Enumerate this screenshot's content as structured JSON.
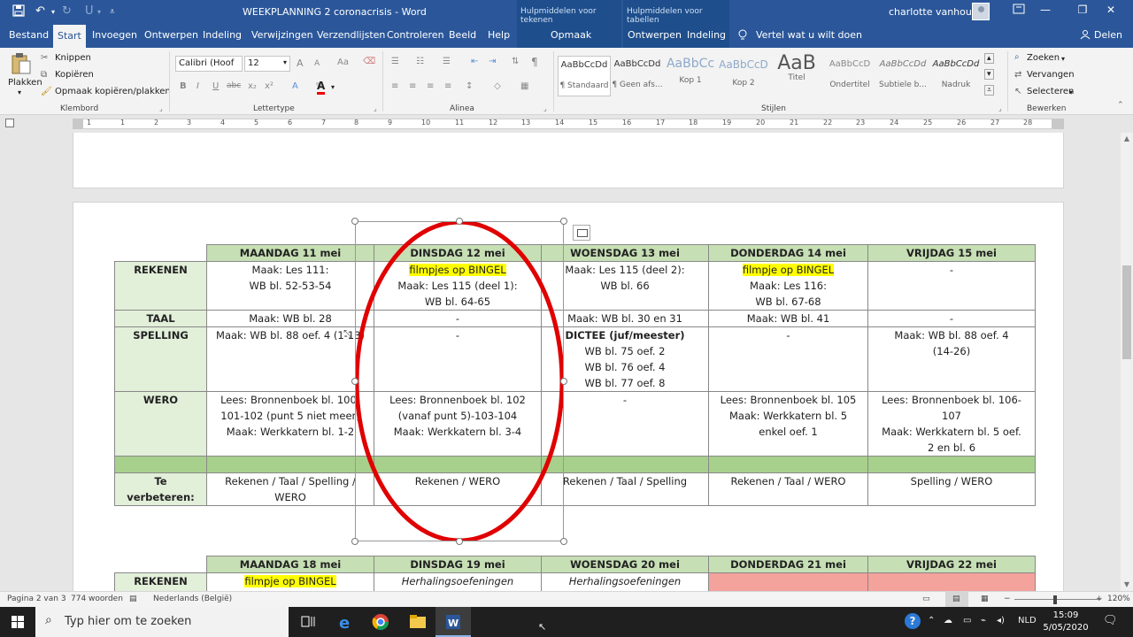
{
  "window": {
    "title": "WEEKPLANNING 2 coronacrisis  -  Word",
    "context_tools": [
      "Hulpmiddelen voor tekenen",
      "Hulpmiddelen voor tabellen"
    ],
    "user": "charlotte vanhoutte"
  },
  "tabs": {
    "file": "Bestand",
    "home": "Start",
    "insert": "Invoegen",
    "design": "Ontwerpen",
    "layout": "Indeling",
    "references": "Verwijzingen",
    "mailings": "Verzendlijsten",
    "review": "Controleren",
    "view": "Beeld",
    "help": "Help",
    "shape_format": "Opmaak",
    "table_design": "Ontwerpen",
    "table_layout": "Indeling",
    "tell_me": "Vertel wat u wilt doen",
    "share": "Delen"
  },
  "ribbon": {
    "clipboard": {
      "paste": "Plakken",
      "cut": "Knippen",
      "copy": "Kopiëren",
      "format_painter": "Opmaak kopiëren/plakken",
      "label": "Klembord"
    },
    "font": {
      "family": "Calibri (Hoof",
      "size": "12",
      "grow": "A",
      "shrink": "A",
      "case": "Aa",
      "bold": "B",
      "italic": "I",
      "underline": "U",
      "strike": "abc",
      "label": "Lettertype"
    },
    "paragraph": {
      "label": "Alinea"
    },
    "styles": {
      "items": [
        {
          "sample": "AaBbCcDd",
          "name": "¶ Standaard"
        },
        {
          "sample": "AaBbCcDd",
          "name": "¶ Geen afs..."
        },
        {
          "sample": "AaBbCc",
          "name": "Kop 1"
        },
        {
          "sample": "AaBbCcD",
          "name": "Kop 2"
        },
        {
          "sample": "AaB",
          "name": "Titel"
        },
        {
          "sample": "AaBbCcD",
          "name": "Ondertitel"
        },
        {
          "sample": "AaBbCcDd",
          "name": "Subtiele b..."
        },
        {
          "sample": "AaBbCcDd",
          "name": "Nadruk"
        }
      ],
      "label": "Stijlen"
    },
    "editing": {
      "find": "Zoeken",
      "replace": "Vervangen",
      "select": "Selecteren",
      "label": "Bewerken"
    }
  },
  "ruler": {
    "marks": [
      "1",
      "1",
      "2",
      "3",
      "4",
      "5",
      "6",
      "7",
      "8",
      "9",
      "10",
      "11",
      "12",
      "13",
      "14",
      "15",
      "16",
      "17",
      "18",
      "19",
      "20",
      "21",
      "22",
      "23",
      "24",
      "25",
      "26",
      "27",
      "28"
    ]
  },
  "table1": {
    "headers": [
      "MAANDAG 11 mei",
      "DINSDAG 12 mei",
      "WOENSDAG 13 mei",
      "DONDERDAG 14 mei",
      "VRIJDAG 15 mei"
    ],
    "rows": [
      {
        "subject": "REKENEN",
        "cells": [
          {
            "lines": [
              {
                "t": "Maak: Les 111:"
              },
              {
                "t": "WB bl. 52-53-54"
              }
            ]
          },
          {
            "lines": [
              {
                "t": "filmpjes op BINGEL",
                "hl": true
              },
              {
                "t": "Maak: Les 115 (deel 1):"
              },
              {
                "t": "WB bl. 64-65"
              }
            ]
          },
          {
            "lines": [
              {
                "t": "Maak: Les 115 (deel 2):"
              },
              {
                "t": "WB bl. 66"
              }
            ]
          },
          {
            "lines": [
              {
                "t": "filmpje op BINGEL",
                "hl": true
              },
              {
                "t": "Maak: Les 116:"
              },
              {
                "t": "WB bl. 67-68"
              }
            ]
          },
          {
            "lines": [
              {
                "t": "-"
              }
            ]
          }
        ]
      },
      {
        "subject": "TAAL",
        "cells": [
          {
            "lines": [
              {
                "t": "Maak: WB bl. 28"
              }
            ]
          },
          {
            "lines": [
              {
                "t": "-"
              }
            ]
          },
          {
            "lines": [
              {
                "t": "Maak: WB bl. 30 en 31"
              }
            ]
          },
          {
            "lines": [
              {
                "t": "Maak: WB bl. 41"
              }
            ]
          },
          {
            "lines": [
              {
                "t": "-"
              }
            ]
          }
        ]
      },
      {
        "subject": "SPELLING",
        "cells": [
          {
            "lines": [
              {
                "t": "Maak: WB bl. 88 oef. 4 (1-13)"
              }
            ]
          },
          {
            "lines": [
              {
                "t": "-"
              }
            ]
          },
          {
            "lines": [
              {
                "t": "DICTEE (juf/meester)",
                "b": true
              },
              {
                "t": "WB bl. 75 oef. 2"
              },
              {
                "t": "WB bl. 76 oef. 4"
              },
              {
                "t": "WB bl. 77 oef. 8"
              }
            ]
          },
          {
            "lines": [
              {
                "t": "-"
              }
            ]
          },
          {
            "lines": [
              {
                "t": "Maak: WB bl. 88 oef. 4"
              },
              {
                "t": "(14-26)"
              }
            ]
          }
        ]
      },
      {
        "subject": "WERO",
        "cells": [
          {
            "lines": [
              {
                "t": "Lees: Bronnenboek bl. 100-"
              },
              {
                "t": "101-102 (punt 5 niet meer)"
              },
              {
                "t": "Maak: Werkkatern bl. 1-2"
              }
            ]
          },
          {
            "lines": [
              {
                "t": "Lees: Bronnenboek bl. 102"
              },
              {
                "t": "(vanaf punt 5)-103-104"
              },
              {
                "t": "Maak: Werkkatern bl. 3-4"
              }
            ]
          },
          {
            "lines": [
              {
                "t": "-"
              }
            ]
          },
          {
            "lines": [
              {
                "t": "Lees: Bronnenboek bl. 105"
              },
              {
                "t": "Maak: Werkkatern bl. 5"
              },
              {
                "t": "enkel oef. 1"
              }
            ]
          },
          {
            "lines": [
              {
                "t": "Lees: Bronnenboek bl. 106-"
              },
              {
                "t": "107"
              },
              {
                "t": "Maak: Werkkatern bl. 5 oef."
              },
              {
                "t": "2 en bl. 6"
              }
            ]
          }
        ]
      }
    ],
    "improve": {
      "subject_lines": [
        "Te",
        "verbeteren:"
      ],
      "cells": [
        {
          "lines": [
            {
              "t": "Rekenen / Taal / Spelling /"
            },
            {
              "t": "WERO"
            }
          ]
        },
        {
          "lines": [
            {
              "t": "Rekenen / WERO"
            }
          ]
        },
        {
          "lines": [
            {
              "t": "Rekenen / Taal / Spelling"
            }
          ]
        },
        {
          "lines": [
            {
              "t": "Rekenen / Taal / WERO"
            }
          ]
        },
        {
          "lines": [
            {
              "t": "Spelling / WERO"
            }
          ]
        }
      ]
    }
  },
  "table2": {
    "headers": [
      "MAANDAG 18 mei",
      "DINSDAG 19 mei",
      "WOENSDAG 20 mei",
      "DONDERDAG 21 mei",
      "VRIJDAG 22 mei"
    ],
    "first_row": {
      "subject": "REKENEN",
      "cells": [
        {
          "lines": [
            {
              "t": "filmpje op BINGEL",
              "hl": true
            }
          ]
        },
        {
          "lines": [
            {
              "t": "Herhalingsoefeningen",
              "it": true
            }
          ]
        },
        {
          "lines": [
            {
              "t": "Herhalingsoefeningen",
              "it": true
            }
          ]
        },
        {
          "lines": [],
          "pink": true
        },
        {
          "lines": [],
          "pink": true
        }
      ]
    }
  },
  "status": {
    "page": "Pagina 2 van 3",
    "words": "774 woorden",
    "language": "Nederlands (België)",
    "zoom": "120%"
  },
  "taskbar": {
    "search_placeholder": "Typ hier om te zoeken",
    "language": "NLD",
    "time": "15:09",
    "date": "5/05/2020"
  },
  "colors": {
    "word_blue": "#2b579a",
    "header_green": "#c6dfb4",
    "subject_green": "#e2efd9",
    "band_green": "#a8d08d",
    "highlight": "#ffff00",
    "ellipse_red": "#e00000",
    "pink": "#f4a29c"
  }
}
